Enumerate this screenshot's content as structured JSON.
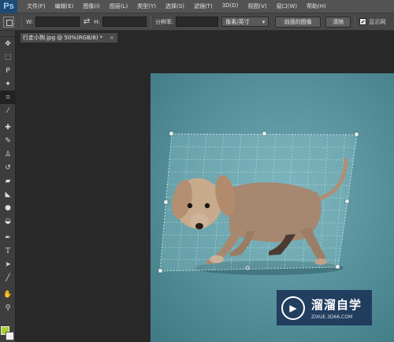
{
  "app": {
    "logo": "Ps"
  },
  "menu": [
    "文件(F)",
    "编辑(E)",
    "图像(I)",
    "图层(L)",
    "类型(Y)",
    "选择(S)",
    "滤镜(T)",
    "3D(D)",
    "视图(V)",
    "窗口(W)",
    "帮助(H)"
  ],
  "options": {
    "w_label": "W:",
    "h_label": "H:",
    "resolution_label": "分辨率:",
    "unit_value": "像素/英寸",
    "front_image_button": "前面的图像",
    "clear_button": "清除",
    "show_grid_label": "显示网"
  },
  "document": {
    "tab_title": "行走小狗.jpg @ 50%(RGB/8) *",
    "tab_close": "×"
  },
  "tools": [
    "move-icon",
    "marquee-icon",
    "lasso-icon",
    "magic-wand-icon",
    "crop-icon",
    "eyedropper-icon",
    "healing-brush-icon",
    "brush-icon",
    "clone-stamp-icon",
    "history-brush-icon",
    "eraser-icon",
    "paint-bucket-icon",
    "blur-icon",
    "dodge-icon",
    "pen-icon",
    "type-icon",
    "path-select-icon",
    "line-icon",
    "hand-icon",
    "zoom-icon"
  ],
  "colors": {
    "foreground": "#a6d22e",
    "background": "#f0f0f0",
    "canvas": "#5a949e"
  },
  "watermark": {
    "title": "溜溜自学",
    "url": "ZIXUE.3D66.COM"
  }
}
